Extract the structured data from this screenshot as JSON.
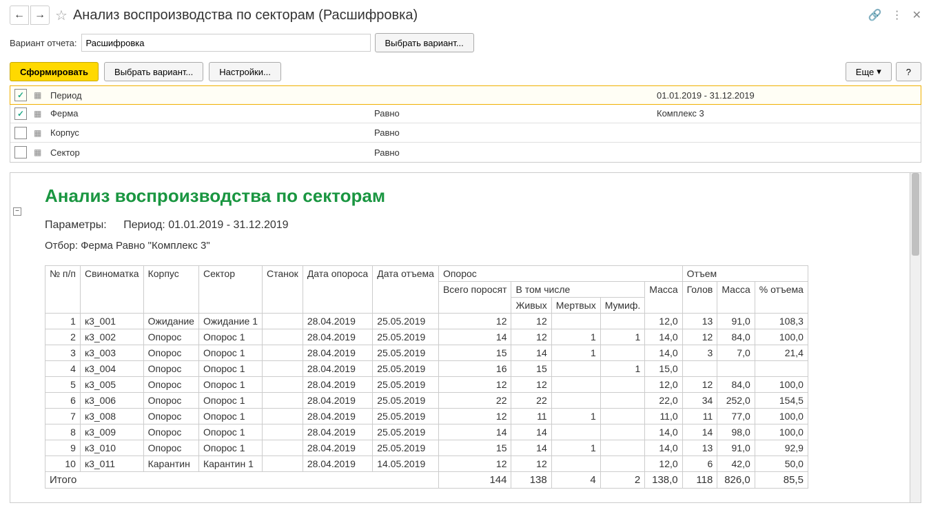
{
  "header": {
    "title": "Анализ воспроизводства по секторам (Расшифровка)"
  },
  "variant": {
    "label": "Вариант отчета:",
    "value": "Расшифровка",
    "choose_btn": "Выбрать вариант..."
  },
  "toolbar": {
    "form_btn": "Сформировать",
    "choose_btn": "Выбрать вариант...",
    "settings_btn": "Настройки...",
    "more_btn": "Еще",
    "help_btn": "?"
  },
  "filters": [
    {
      "checked": true,
      "name": "Период",
      "op": "",
      "val": "01.01.2019 - 31.12.2019",
      "active": true
    },
    {
      "checked": true,
      "name": "Ферма",
      "op": "Равно",
      "val": "Комплекс 3",
      "active": false
    },
    {
      "checked": false,
      "name": "Корпус",
      "op": "Равно",
      "val": "",
      "active": false
    },
    {
      "checked": false,
      "name": "Сектор",
      "op": "Равно",
      "val": "",
      "active": false
    }
  ],
  "report": {
    "title": "Анализ воспроизводства по секторам",
    "params_label": "Параметры:",
    "params_value": "Период: 01.01.2019 - 31.12.2019",
    "filter_text": "Отбор: Ферма Равно \"Комплекс 3\"",
    "headers": {
      "num": "№ п/п",
      "sow": "Свиноматка",
      "building": "Корпус",
      "sector": "Сектор",
      "pen": "Станок",
      "farrow_date": "Дата опороса",
      "wean_date": "Дата отъема",
      "farrow": "Опорос",
      "total_piglets": "Всего поросят",
      "including": "В том числе",
      "alive": "Живых",
      "dead": "Мертвых",
      "mummif": "Мумиф.",
      "mass": "Масса",
      "wean": "Отъем",
      "heads": "Голов",
      "pct_wean": "% отъема"
    },
    "rows": [
      {
        "n": "1",
        "sow": "к3_001",
        "bldg": "Ожидание",
        "sect": "Ожидание 1",
        "pen": "",
        "fd": "28.04.2019",
        "wd": "25.05.2019",
        "tot": "12",
        "alive": "12",
        "dead": "",
        "mum": "",
        "mass": "12,0",
        "wh": "13",
        "wm": "91,0",
        "pct": "108,3"
      },
      {
        "n": "2",
        "sow": "к3_002",
        "bldg": "Опорос",
        "sect": "Опорос 1",
        "pen": "",
        "fd": "28.04.2019",
        "wd": "25.05.2019",
        "tot": "14",
        "alive": "12",
        "dead": "1",
        "mum": "1",
        "mass": "14,0",
        "wh": "12",
        "wm": "84,0",
        "pct": "100,0"
      },
      {
        "n": "3",
        "sow": "к3_003",
        "bldg": "Опорос",
        "sect": "Опорос 1",
        "pen": "",
        "fd": "28.04.2019",
        "wd": "25.05.2019",
        "tot": "15",
        "alive": "14",
        "dead": "1",
        "mum": "",
        "mass": "14,0",
        "wh": "3",
        "wm": "7,0",
        "pct": "21,4"
      },
      {
        "n": "4",
        "sow": "к3_004",
        "bldg": "Опорос",
        "sect": "Опорос 1",
        "pen": "",
        "fd": "28.04.2019",
        "wd": "25.05.2019",
        "tot": "16",
        "alive": "15",
        "dead": "",
        "mum": "1",
        "mass": "15,0",
        "wh": "",
        "wm": "",
        "pct": ""
      },
      {
        "n": "5",
        "sow": "к3_005",
        "bldg": "Опорос",
        "sect": "Опорос 1",
        "pen": "",
        "fd": "28.04.2019",
        "wd": "25.05.2019",
        "tot": "12",
        "alive": "12",
        "dead": "",
        "mum": "",
        "mass": "12,0",
        "wh": "12",
        "wm": "84,0",
        "pct": "100,0"
      },
      {
        "n": "6",
        "sow": "к3_006",
        "bldg": "Опорос",
        "sect": "Опорос 1",
        "pen": "",
        "fd": "28.04.2019",
        "wd": "25.05.2019",
        "tot": "22",
        "alive": "22",
        "dead": "",
        "mum": "",
        "mass": "22,0",
        "wh": "34",
        "wm": "252,0",
        "pct": "154,5"
      },
      {
        "n": "7",
        "sow": "к3_008",
        "bldg": "Опорос",
        "sect": "Опорос 1",
        "pen": "",
        "fd": "28.04.2019",
        "wd": "25.05.2019",
        "tot": "12",
        "alive": "11",
        "dead": "1",
        "mum": "",
        "mass": "11,0",
        "wh": "11",
        "wm": "77,0",
        "pct": "100,0"
      },
      {
        "n": "8",
        "sow": "к3_009",
        "bldg": "Опорос",
        "sect": "Опорос 1",
        "pen": "",
        "fd": "28.04.2019",
        "wd": "25.05.2019",
        "tot": "14",
        "alive": "14",
        "dead": "",
        "mum": "",
        "mass": "14,0",
        "wh": "14",
        "wm": "98,0",
        "pct": "100,0"
      },
      {
        "n": "9",
        "sow": "к3_010",
        "bldg": "Опорос",
        "sect": "Опорос 1",
        "pen": "",
        "fd": "28.04.2019",
        "wd": "25.05.2019",
        "tot": "15",
        "alive": "14",
        "dead": "1",
        "mum": "",
        "mass": "14,0",
        "wh": "13",
        "wm": "91,0",
        "pct": "92,9"
      },
      {
        "n": "10",
        "sow": "к3_011",
        "bldg": "Карантин",
        "sect": "Карантин 1",
        "pen": "",
        "fd": "28.04.2019",
        "wd": "14.05.2019",
        "tot": "12",
        "alive": "12",
        "dead": "",
        "mum": "",
        "mass": "12,0",
        "wh": "6",
        "wm": "42,0",
        "pct": "50,0"
      }
    ],
    "total": {
      "label": "Итого",
      "tot": "144",
      "alive": "138",
      "dead": "4",
      "mum": "2",
      "mass": "138,0",
      "wh": "118",
      "wm": "826,0",
      "pct": "85,5"
    }
  }
}
